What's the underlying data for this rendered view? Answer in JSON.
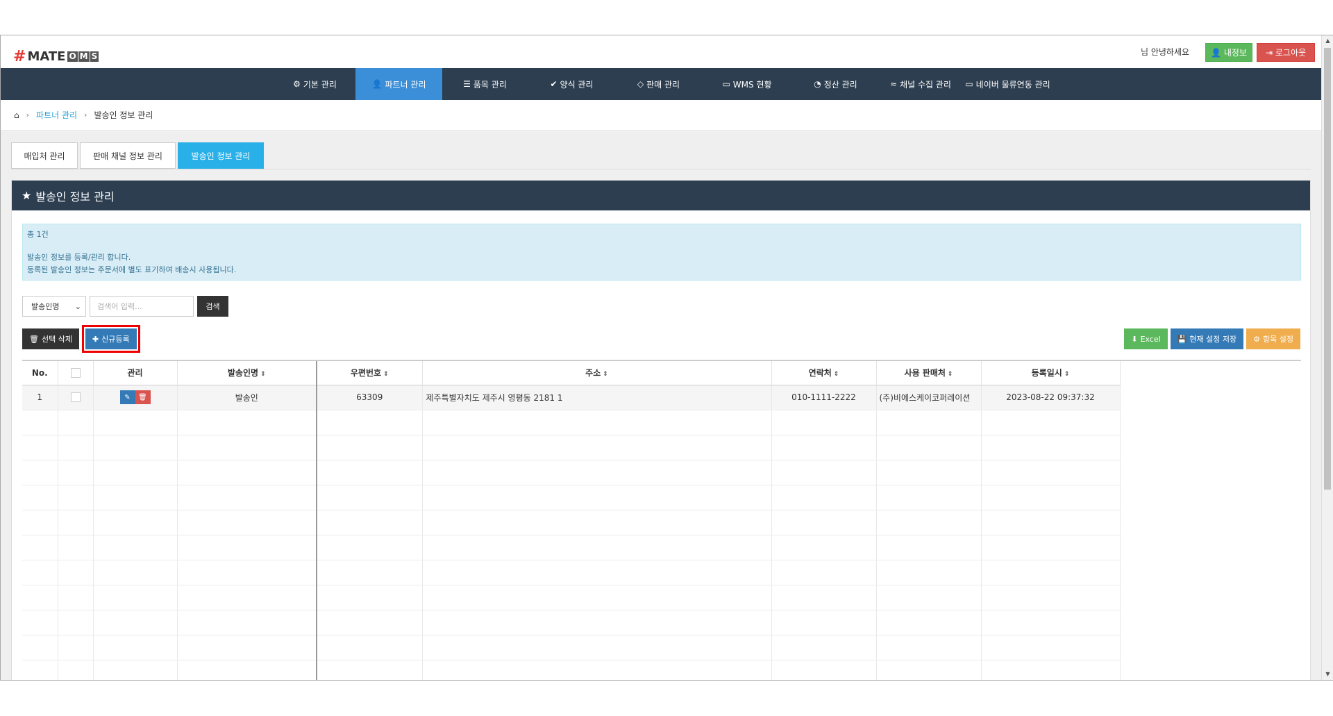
{
  "header": {
    "logo_text": "MATE",
    "logo_oms": [
      "O",
      "M",
      "S"
    ],
    "greeting": "님 안녕하세요",
    "my_info_label": "내정보",
    "logout_label": "로그아웃"
  },
  "nav": [
    {
      "label": "기본 관리",
      "icon": "gear-icon"
    },
    {
      "label": "파트너 관리",
      "icon": "user-icon",
      "active": true
    },
    {
      "label": "품목 관리",
      "icon": "list-icon"
    },
    {
      "label": "양식 관리",
      "icon": "check-icon"
    },
    {
      "label": "판매 관리",
      "icon": "diamond-icon"
    },
    {
      "label": "WMS 현황",
      "icon": "card-icon"
    },
    {
      "label": "정산 관리",
      "icon": "pie-icon"
    },
    {
      "label": "채널 수집 관리",
      "icon": "rss-icon"
    },
    {
      "label": "네이버 물류연동 관리",
      "icon": "card-icon"
    }
  ],
  "breadcrumb": {
    "parent": "파트너 관리",
    "current": "발송인 정보 관리"
  },
  "tabs": [
    {
      "label": "매입처 관리"
    },
    {
      "label": "판매 채널 정보 관리"
    },
    {
      "label": "발송인 정보 관리",
      "active": true
    }
  ],
  "panel": {
    "title": "발송인 정보 관리"
  },
  "info": {
    "count": "총 1건",
    "line1": "발송인 정보를 등록/관리 합니다.",
    "line2": "등록된 발송인 정보는 주문서에 별도 표기하여 배송시 사용됩니다."
  },
  "search": {
    "select_value": "발송인명",
    "placeholder": "검색어 입력...",
    "button": "검색"
  },
  "actions": {
    "delete_selected": "선택 삭제",
    "new_register": "신규등록",
    "excel": "Excel",
    "save_settings": "현재 설정 저장",
    "column_settings": "항목 설정"
  },
  "table": {
    "columns": [
      "No.",
      "",
      "관리",
      "발송인명",
      "우편번호",
      "주소",
      "연락처",
      "사용 판매처",
      "등록일시"
    ],
    "rows": [
      {
        "no": "1",
        "sender": "발송인",
        "zip": "63309",
        "address": "제주특별자치도 제주시 영평동 2181 1",
        "phone": "010-1111-2222",
        "seller": "(주)비에스케이코퍼레이션",
        "date": "2023-08-22 09:37:32"
      }
    ]
  },
  "colors": {
    "nav_bg": "#2c3e50",
    "nav_active": "#3a8fd8",
    "tab_active": "#2ab0e8",
    "highlight_border": "#e00000"
  }
}
